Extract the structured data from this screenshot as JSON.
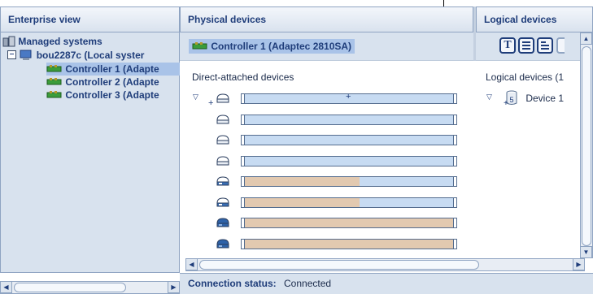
{
  "headers": {
    "enterprise": "Enterprise view",
    "physical": "Physical devices",
    "logical": "Logical devices"
  },
  "tree": {
    "root": "Managed systems",
    "system": "bou2287c (Local syster",
    "controllers": [
      "Controller 1 (Adapte",
      "Controller 2 (Adapte",
      "Controller 3 (Adapte"
    ]
  },
  "controller_bar": {
    "label": "Controller 1 (Adaptec 2810SA)",
    "view_buttons": [
      "T",
      "",
      ""
    ]
  },
  "physical": {
    "section_label": "Direct-attached devices",
    "devices": [
      {
        "icon": "empty-drive-icon",
        "used": 0.0
      },
      {
        "icon": "empty-drive-icon",
        "used": 0.0
      },
      {
        "icon": "empty-drive-icon",
        "used": 0.0
      },
      {
        "icon": "empty-drive-icon",
        "used": 0.0
      },
      {
        "icon": "used-drive-icon",
        "used": 0.55
      },
      {
        "icon": "used-drive-icon",
        "used": 0.55
      },
      {
        "icon": "full-drive-icon",
        "used": 1.0
      },
      {
        "icon": "full-drive-icon",
        "used": 1.0
      }
    ]
  },
  "logical": {
    "section_label": "Logical devices (1",
    "device_label": "Device 1",
    "raid_badge": "5"
  },
  "status": {
    "label": "Connection status:",
    "value": "Connected"
  },
  "colors": {
    "header_text": "#1f3d7a",
    "used_fill": "#e2c9b0",
    "free_fill": "#c7dbf2"
  }
}
